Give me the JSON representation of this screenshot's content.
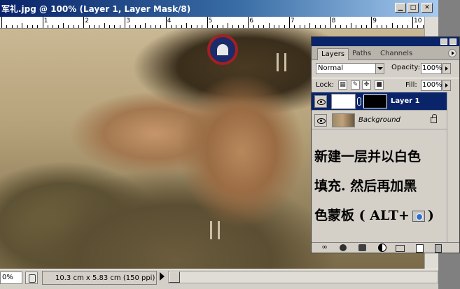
{
  "document": {
    "title": "军礼.jpg @ 100% (Layer 1, Layer Mask/8)",
    "window_buttons": [
      "minimize",
      "maximize",
      "close"
    ],
    "ruler_numbers": [
      "1",
      "2",
      "3",
      "4",
      "5",
      "6",
      "7",
      "8",
      "9",
      "10"
    ]
  },
  "statusbar": {
    "zoom": "0%",
    "doc_info": "10.3 cm x 5.83 cm (150 ppi)"
  },
  "palette": {
    "tabs": [
      {
        "label": "Layers",
        "active": true
      },
      {
        "label": "Paths",
        "active": false
      },
      {
        "label": "Channels",
        "active": false
      }
    ],
    "blend_mode": "Normal",
    "opacity_label": "Opacity:",
    "opacity_value": "100%",
    "lock_label": "Lock:",
    "lock_icons": [
      "transparency-lock-icon",
      "brush-lock-icon",
      "move-lock-icon",
      "all-lock-icon"
    ],
    "fill_label": "Fill:",
    "fill_value": "100%",
    "layers": [
      {
        "name": "Layer 1",
        "selected": true,
        "visible": true,
        "has_mask": true
      },
      {
        "name": "Background",
        "selected": false,
        "visible": true,
        "locked": true
      }
    ],
    "annotation": {
      "line1": "新建一层并以白色",
      "line2": "填充. 然后再加黑",
      "line3_prefix": "色蒙板 ( ALT+",
      "line3_suffix": ")"
    },
    "bottom_tools": [
      "link-icon",
      "layer-style-icon",
      "add-mask-icon",
      "adjustment-layer-icon",
      "new-group-icon",
      "new-layer-icon",
      "delete-layer-icon"
    ]
  }
}
